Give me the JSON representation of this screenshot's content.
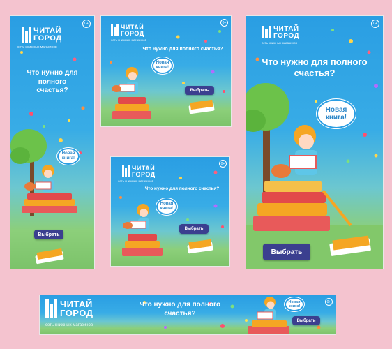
{
  "brand": {
    "line1": "ЧИТАЙ",
    "line2": "ГОРОД",
    "tagline": "сеть книжных магазинов"
  },
  "headline": "Что нужно для полного счастья?",
  "headline_lines": [
    "Что нужно для полного",
    "счастья?"
  ],
  "bubble": {
    "line1": "Новая",
    "line2": "книга!"
  },
  "cta_label": "Выбрать",
  "age_badge": "0+",
  "colors": {
    "background": "#f4c3cf",
    "sky": "#2a9ee3",
    "grass": "#8ccf7a",
    "button": "#3b3f8f",
    "hair": "#f5a623"
  }
}
